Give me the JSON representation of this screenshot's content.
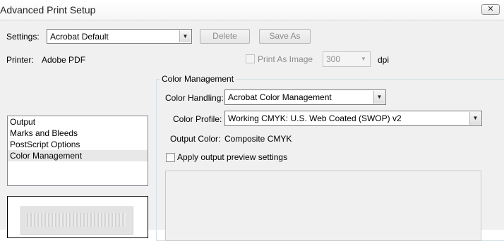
{
  "window": {
    "title": "Advanced Print Setup",
    "close_label": "✕"
  },
  "settings": {
    "label": "Settings:",
    "value": "Acrobat Default",
    "delete_label": "Delete",
    "save_as_label": "Save As"
  },
  "printer": {
    "label": "Printer:",
    "value": "Adobe PDF",
    "print_as_image_label": "Print As Image",
    "dpi_value": "300",
    "dpi_unit": "dpi"
  },
  "sidebar": {
    "items": [
      {
        "label": "Output"
      },
      {
        "label": "Marks and Bleeds"
      },
      {
        "label": "PostScript Options"
      },
      {
        "label": "Color Management"
      }
    ],
    "selected": "Color Management"
  },
  "color_management": {
    "group_title": "Color Management",
    "color_handling_label": "Color Handling:",
    "color_handling_value": "Acrobat Color Management",
    "color_profile_label": "Color Profile:",
    "color_profile_value": "Working CMYK: U.S. Web Coated (SWOP) v2",
    "output_color_label": "Output Color:",
    "output_color_value": "Composite CMYK",
    "apply_preview_label": "Apply output preview settings"
  },
  "icons": {
    "dropdown": "chevron-down-icon",
    "close": "close-icon"
  }
}
